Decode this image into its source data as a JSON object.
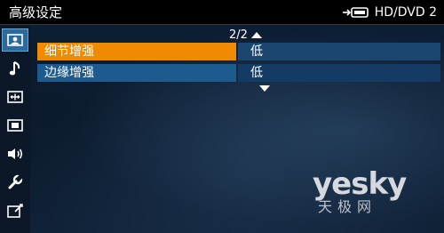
{
  "header": {
    "title": "高级设定",
    "source_label": "HD/DVD 2",
    "source_icon": "input-source-icon"
  },
  "sidebar": {
    "items": [
      {
        "icon": "picture-icon",
        "active": true
      },
      {
        "icon": "music-note-icon",
        "active": false
      },
      {
        "icon": "screen-size-icon",
        "active": false
      },
      {
        "icon": "screen-position-icon",
        "active": false
      },
      {
        "icon": "speaker-icon",
        "active": false
      },
      {
        "icon": "wrench-icon",
        "active": false
      },
      {
        "icon": "setup-icon",
        "active": false
      }
    ]
  },
  "menu": {
    "page_indicator": "2/2",
    "rows": [
      {
        "label": "细节增强",
        "value": "低",
        "selected": true
      },
      {
        "label": "边缘增强",
        "value": "低",
        "selected": false
      }
    ]
  },
  "watermark": {
    "brand": "yesky",
    "sub": "天极网"
  },
  "colors": {
    "selected_label": "#f08a00",
    "row_label": "#1d5a8e",
    "row_value": "#143b63",
    "active_icon_bg": "#2c6a9c"
  }
}
